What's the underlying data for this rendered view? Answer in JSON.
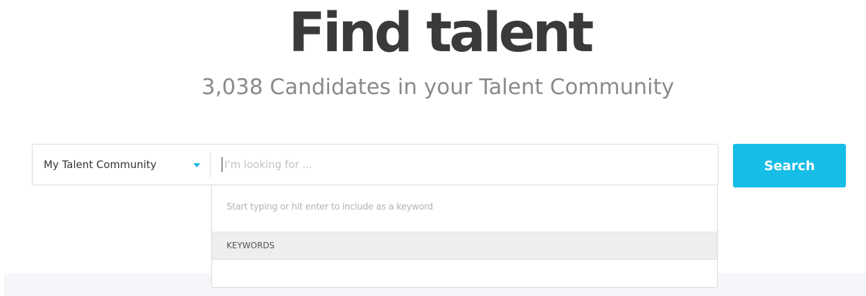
{
  "header": {
    "title": "Find talent",
    "subtitle": "3,038 Candidates in your Talent Community"
  },
  "search": {
    "scope": {
      "selected": "My Talent Community",
      "caret_icon": "chevron-down-icon"
    },
    "input": {
      "value": "",
      "placeholder": "I'm looking for ..."
    },
    "button_label": "Search"
  },
  "suggestions": {
    "hint": "Start typing or hit enter to include as a keyword",
    "section_header": "KEYWORDS"
  },
  "colors": {
    "accent": "#16bde6",
    "title": "#3a3a3a",
    "subtitle": "#8a8a8a"
  }
}
